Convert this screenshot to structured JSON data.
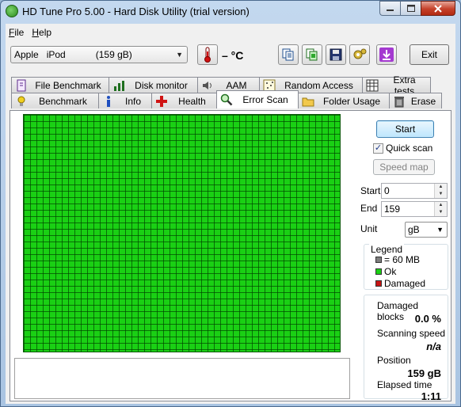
{
  "window": {
    "title": "HD Tune Pro 5.00 - Hard Disk Utility (trial version)"
  },
  "menu": {
    "items": [
      {
        "key": "F",
        "rest": "ile"
      },
      {
        "key": "H",
        "rest": "elp"
      }
    ]
  },
  "toolbar": {
    "drive_vendor": "Apple",
    "drive_model": "iPod",
    "drive_capacity": "(159 gB)",
    "temperature": "– °C",
    "exit_label": "Exit"
  },
  "tabs": {
    "top_row": [
      {
        "label": "File Benchmark",
        "icon": "file-benchmark-icon"
      },
      {
        "label": "Disk monitor",
        "icon": "disk-monitor-icon"
      },
      {
        "label": "AAM",
        "icon": "speaker-icon"
      },
      {
        "label": "Random Access",
        "icon": "random-access-icon"
      },
      {
        "label": "Extra tests",
        "icon": "extra-tests-icon"
      }
    ],
    "bottom_row": [
      {
        "label": "Benchmark",
        "icon": "benchmark-icon"
      },
      {
        "label": "Info",
        "icon": "info-icon"
      },
      {
        "label": "Health",
        "icon": "health-icon"
      },
      {
        "label": "Error Scan",
        "icon": "magnifier-icon",
        "active": true
      },
      {
        "label": "Folder Usage",
        "icon": "folder-icon"
      },
      {
        "label": "Erase",
        "icon": "trash-icon"
      }
    ]
  },
  "scan": {
    "start_label": "Start",
    "quick_scan_label": "Quick scan",
    "quick_scan_checked": true,
    "speed_map_label": "Speed map",
    "start_field_label": "Start",
    "start_value": "0",
    "end_field_label": "End",
    "end_value": "159",
    "unit_label": "Unit",
    "unit_value": "gB"
  },
  "legend": {
    "title": "Legend",
    "items": [
      {
        "label": "= 60 MB",
        "color": "#7f7f7f"
      },
      {
        "label": "Ok",
        "color": "#1ad014"
      },
      {
        "label": "Damaged",
        "color": "#c81414"
      }
    ]
  },
  "stats": {
    "damaged_label": "Damaged blocks",
    "damaged_value": "0.0 %",
    "speed_label": "Scanning speed",
    "speed_value": "n/a",
    "position_label": "Position",
    "position_value": "159 gB",
    "elapsed_label": "Elapsed time",
    "elapsed_value": "1:11"
  },
  "colors": {
    "ok_block": "#1ad014",
    "grid_line": "#0b5a08",
    "accent": "#3c7fb1"
  }
}
